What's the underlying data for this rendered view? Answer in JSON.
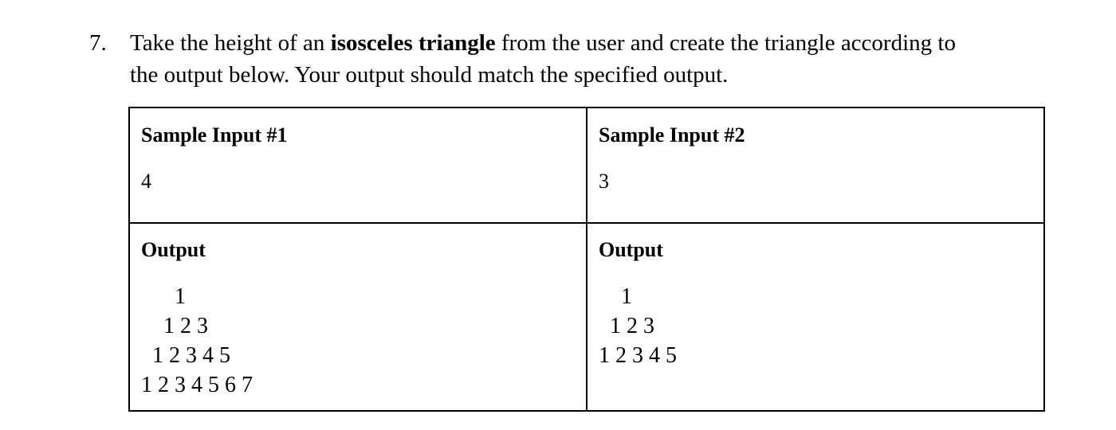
{
  "question": {
    "number": "7.",
    "line1_pre": "Take the height of an ",
    "line1_bold": "isosceles triangle",
    "line1_post": " from the user and create the triangle according to",
    "line2": "the output below. Your output should match the specified output."
  },
  "samples": [
    {
      "input_title": "Sample Input #1",
      "input_value": "4",
      "output_title": "Output",
      "output_lines": [
        "      1",
        "    1 2 3",
        "  1 2 3 4 5",
        "1 2 3 4 5 6 7"
      ]
    },
    {
      "input_title": "Sample Input #2",
      "input_value": "3",
      "output_title": "Output",
      "output_lines": [
        "    1",
        "  1 2 3",
        "1 2 3 4 5"
      ]
    }
  ]
}
